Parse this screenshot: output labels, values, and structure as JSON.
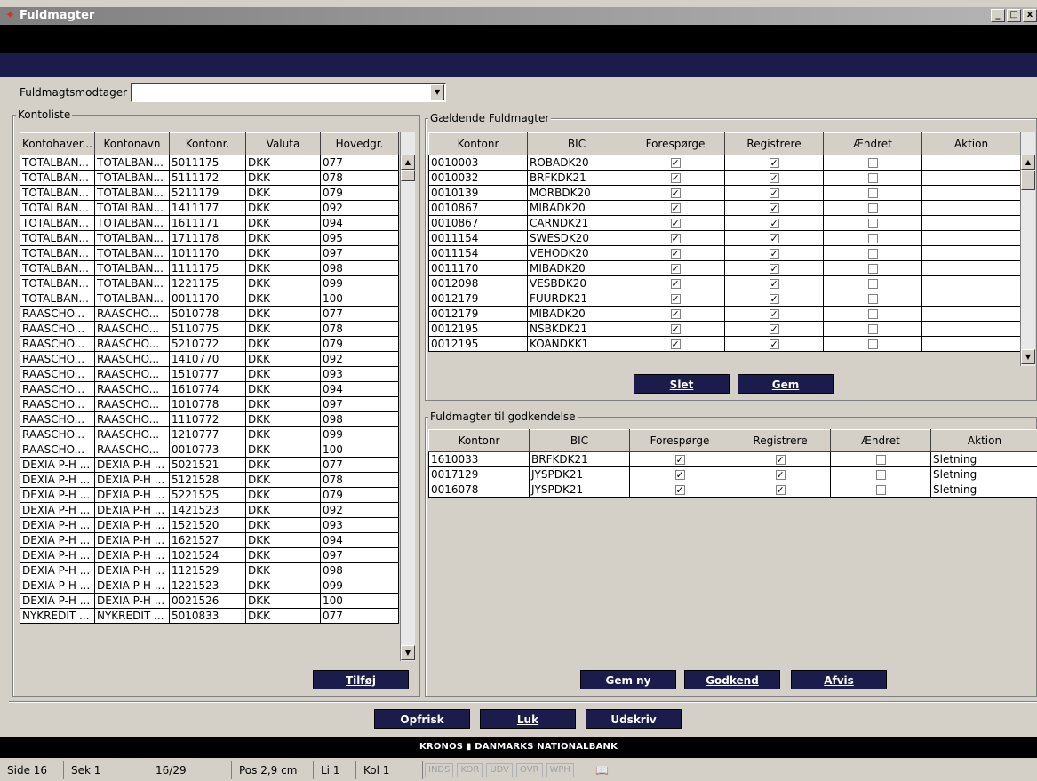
{
  "window": {
    "title": "Fuldmagter",
    "controls": [
      "_",
      "□",
      "x"
    ]
  },
  "recipient": {
    "label": "Fuldmagtsmodtager",
    "value": ""
  },
  "kontoliste": {
    "legend": "Kontoliste",
    "columns": [
      "Kontohaver...",
      "Kontonavn",
      "Kontonr.",
      "Valuta",
      "Hovedgr."
    ],
    "rows": [
      [
        "TOTALBAN...",
        "TOTALBAN...",
        "5011175",
        "DKK",
        "077"
      ],
      [
        "TOTALBAN...",
        "TOTALBAN...",
        "5111172",
        "DKK",
        "078"
      ],
      [
        "TOTALBAN...",
        "TOTALBAN...",
        "5211179",
        "DKK",
        "079"
      ],
      [
        "TOTALBAN...",
        "TOTALBAN...",
        "1411177",
        "DKK",
        "092"
      ],
      [
        "TOTALBAN...",
        "TOTALBAN...",
        "1611171",
        "DKK",
        "094"
      ],
      [
        "TOTALBAN...",
        "TOTALBAN...",
        "1711178",
        "DKK",
        "095"
      ],
      [
        "TOTALBAN...",
        "TOTALBAN...",
        "1011170",
        "DKK",
        "097"
      ],
      [
        "TOTALBAN...",
        "TOTALBAN...",
        "1111175",
        "DKK",
        "098"
      ],
      [
        "TOTALBAN...",
        "TOTALBAN...",
        "1221175",
        "DKK",
        "099"
      ],
      [
        "TOTALBAN...",
        "TOTALBAN...",
        "0011170",
        "DKK",
        "100"
      ],
      [
        "RAASCHO...",
        "RAASCHO...",
        "5010778",
        "DKK",
        "077"
      ],
      [
        "RAASCHO...",
        "RAASCHO...",
        "5110775",
        "DKK",
        "078"
      ],
      [
        "RAASCHO...",
        "RAASCHO...",
        "5210772",
        "DKK",
        "079"
      ],
      [
        "RAASCHO...",
        "RAASCHO...",
        "1410770",
        "DKK",
        "092"
      ],
      [
        "RAASCHO...",
        "RAASCHO...",
        "1510777",
        "DKK",
        "093"
      ],
      [
        "RAASCHO...",
        "RAASCHO...",
        "1610774",
        "DKK",
        "094"
      ],
      [
        "RAASCHO...",
        "RAASCHO...",
        "1010778",
        "DKK",
        "097"
      ],
      [
        "RAASCHO...",
        "RAASCHO...",
        "1110772",
        "DKK",
        "098"
      ],
      [
        "RAASCHO...",
        "RAASCHO...",
        "1210777",
        "DKK",
        "099"
      ],
      [
        "RAASCHO...",
        "RAASCHO...",
        "0010773",
        "DKK",
        "100"
      ],
      [
        "DEXIA P-H ...",
        "DEXIA P-H ...",
        "5021521",
        "DKK",
        "077"
      ],
      [
        "DEXIA P-H ...",
        "DEXIA P-H ...",
        "5121528",
        "DKK",
        "078"
      ],
      [
        "DEXIA P-H ...",
        "DEXIA P-H ...",
        "5221525",
        "DKK",
        "079"
      ],
      [
        "DEXIA P-H ...",
        "DEXIA P-H ...",
        "1421523",
        "DKK",
        "092"
      ],
      [
        "DEXIA P-H ...",
        "DEXIA P-H ...",
        "1521520",
        "DKK",
        "093"
      ],
      [
        "DEXIA P-H ...",
        "DEXIA P-H ...",
        "1621527",
        "DKK",
        "094"
      ],
      [
        "DEXIA P-H ...",
        "DEXIA P-H ...",
        "1021524",
        "DKK",
        "097"
      ],
      [
        "DEXIA P-H ...",
        "DEXIA P-H ...",
        "1121529",
        "DKK",
        "098"
      ],
      [
        "DEXIA P-H ...",
        "DEXIA P-H ...",
        "1221523",
        "DKK",
        "099"
      ],
      [
        "DEXIA P-H ...",
        "DEXIA P-H ...",
        "0021526",
        "DKK",
        "100"
      ],
      [
        "NYKREDIT ...",
        "NYKREDIT ...",
        "5010833",
        "DKK",
        "077"
      ]
    ],
    "add_button": "Tilføj"
  },
  "gaeldende": {
    "legend": "Gældende Fuldmagter",
    "columns": [
      "Kontonr",
      "BIC",
      "Forespørge",
      "Registrere",
      "Ændret",
      "Aktion"
    ],
    "rows": [
      [
        "0010003",
        "ROBADK20",
        true,
        true,
        false,
        ""
      ],
      [
        "0010032",
        "BRFKDK21",
        true,
        true,
        false,
        ""
      ],
      [
        "0010139",
        "MORBDK20",
        true,
        true,
        false,
        ""
      ],
      [
        "0010867",
        "MIBADK20",
        true,
        true,
        false,
        ""
      ],
      [
        "0010867",
        "CARNDK21",
        true,
        true,
        false,
        ""
      ],
      [
        "0011154",
        "SWESDK20",
        true,
        true,
        false,
        ""
      ],
      [
        "0011154",
        "VEHODK20",
        true,
        true,
        false,
        ""
      ],
      [
        "0011170",
        "MIBADK20",
        true,
        true,
        false,
        ""
      ],
      [
        "0012098",
        "VESBDK20",
        true,
        true,
        false,
        ""
      ],
      [
        "0012179",
        "FUURDK21",
        true,
        true,
        false,
        ""
      ],
      [
        "0012179",
        "MIBADK20",
        true,
        true,
        false,
        ""
      ],
      [
        "0012195",
        "NSBKDK21",
        true,
        true,
        false,
        ""
      ],
      [
        "0012195",
        "KOANDKK1",
        true,
        true,
        false,
        ""
      ]
    ],
    "delete_button": "Slet",
    "save_button": "Gem"
  },
  "godkendelse": {
    "legend": "Fuldmagter til godkendelse",
    "columns": [
      "Kontonr",
      "BIC",
      "Forespørge",
      "Registrere",
      "Ændret",
      "Aktion"
    ],
    "rows": [
      [
        "1610033",
        "BRFKDK21",
        true,
        true,
        false,
        "Sletning"
      ],
      [
        "0017129",
        "JYSPDK21",
        true,
        true,
        false,
        "Sletning"
      ],
      [
        "0016078",
        "JYSPDK21",
        true,
        true,
        false,
        "Sletning"
      ]
    ],
    "save_new_button": "Gem ny",
    "approve_button": "Godkend",
    "reject_button": "Afvis"
  },
  "actions": {
    "refresh": "Opfrisk",
    "close": "Luk",
    "print": "Udskriv"
  },
  "footer": {
    "brand": "KRONOS ▮ DANMARKS NATIONALBANK"
  },
  "statusbar": {
    "side": "Side 16",
    "sek": "Sek 1",
    "pages": "16/29",
    "pos": "Pos 2,9 cm",
    "li": "Li 1",
    "kol": "Kol 1",
    "modes": [
      "INDS",
      "KOR",
      "UDV",
      "OVR",
      "WPH"
    ]
  }
}
